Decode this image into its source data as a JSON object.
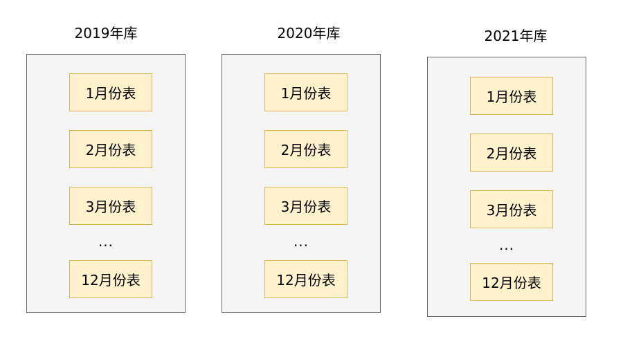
{
  "databases": [
    {
      "title": "2019年库",
      "tables": [
        "1月份表",
        "2月份表",
        "3月份表"
      ],
      "ellipsis": "...",
      "last_table": "12月份表"
    },
    {
      "title": "2020年库",
      "tables": [
        "1月份表",
        "2月份表",
        "3月份表"
      ],
      "ellipsis": "...",
      "last_table": "12月份表"
    },
    {
      "title": "2021年库",
      "tables": [
        "1月份表",
        "2月份表",
        "3月份表"
      ],
      "ellipsis": "...",
      "last_table": "12月份表"
    }
  ],
  "colors": {
    "db_fill": "#f5f5f5",
    "db_border": "#666666",
    "table_fill": "#fff2cc",
    "table_border": "#d6b656"
  }
}
